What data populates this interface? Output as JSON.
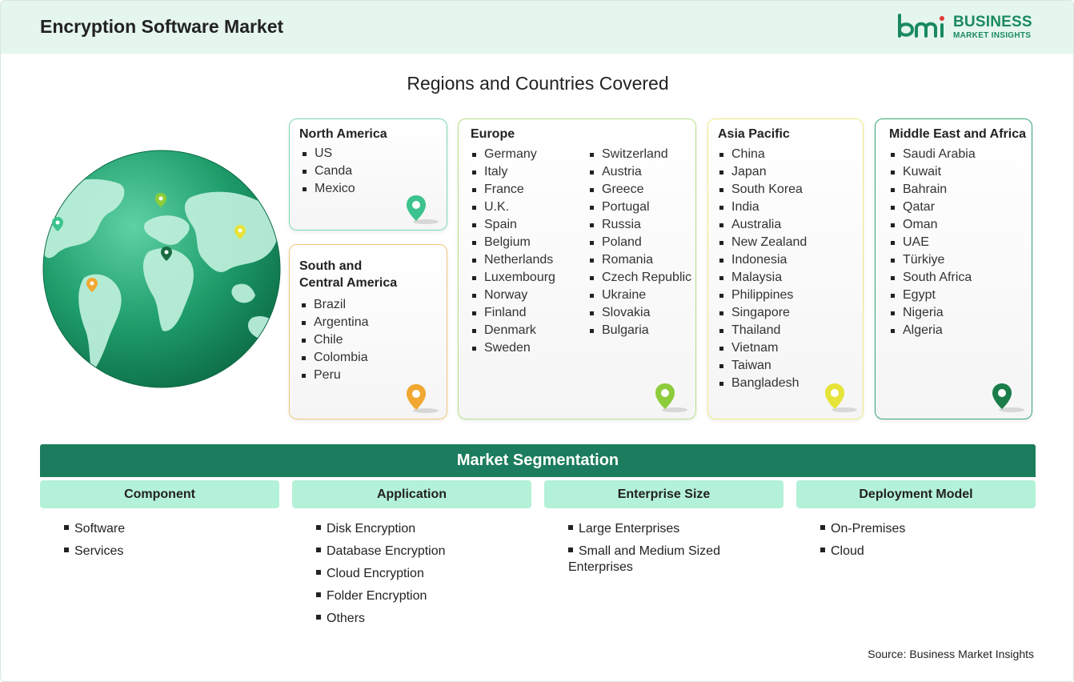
{
  "header": {
    "title": "Encryption Software Market",
    "logo_line1": "BUSINESS",
    "logo_line2": "MARKET INSIGHTS",
    "logo_mark": "bmi"
  },
  "regions_title": "Regions and Countries Covered",
  "regions": {
    "north_america": {
      "title": "North America",
      "items": [
        "US",
        "Canda",
        "Mexico"
      ],
      "color": "#3cc38d"
    },
    "south_america": {
      "title_line1": "South and",
      "title_line2": "Central America",
      "items": [
        "Brazil",
        "Argentina",
        "Chile",
        "Colombia",
        "Peru"
      ],
      "color": "#f0a830"
    },
    "europe": {
      "title": "Europe",
      "items_col1": [
        "Germany",
        "Italy",
        "France",
        "U.K.",
        "Spain",
        "Belgium",
        "Netherlands",
        "Luxembourg",
        "Norway",
        "Finland",
        "Denmark",
        "Sweden"
      ],
      "items_col2": [
        "Switzerland",
        "Austria",
        "Greece",
        "Portugal",
        "Russia",
        "Poland",
        "Romania",
        "Czech Republic",
        "Ukraine",
        "Slovakia",
        "Bulgaria"
      ],
      "color": "#8dcc3a"
    },
    "asia_pacific": {
      "title": "Asia Pacific",
      "items": [
        "China",
        "Japan",
        "South Korea",
        "India",
        "Australia",
        "New Zealand",
        "Indonesia",
        "Malaysia",
        "Philippines",
        "Singapore",
        "Thailand",
        "Vietnam",
        "Taiwan",
        "Bangladesh"
      ],
      "color": "#e6e43a"
    },
    "mea": {
      "title": "Middle East and Africa",
      "items": [
        "Saudi Arabia",
        "Kuwait",
        "Bahrain",
        "Qatar",
        "Oman",
        "UAE",
        "Türkiye",
        "South Africa",
        "Egypt",
        "Nigeria",
        "Algeria"
      ],
      "color": "#1b7d4a"
    }
  },
  "segmentation": {
    "title": "Market Segmentation",
    "columns": [
      {
        "header": "Component",
        "items": [
          "Software",
          "Services"
        ]
      },
      {
        "header": "Application",
        "items": [
          "Disk Encryption",
          "Database Encryption",
          "Cloud Encryption",
          "Folder Encryption",
          "Others"
        ]
      },
      {
        "header": "Enterprise Size",
        "items": [
          "Large Enterprises",
          "Small and Medium Sized Enterprises"
        ]
      },
      {
        "header": "Deployment Model",
        "items": [
          "On-Premises",
          "Cloud"
        ]
      }
    ]
  },
  "source": "Source: Business Market Insights",
  "icons": {
    "pin": "location-pin-icon",
    "globe": "globe-icon"
  },
  "colors": {
    "accent": "#1b7d5d",
    "header_bg": "#e5f6ee",
    "seg_head_bg": "#b4f1d9"
  }
}
